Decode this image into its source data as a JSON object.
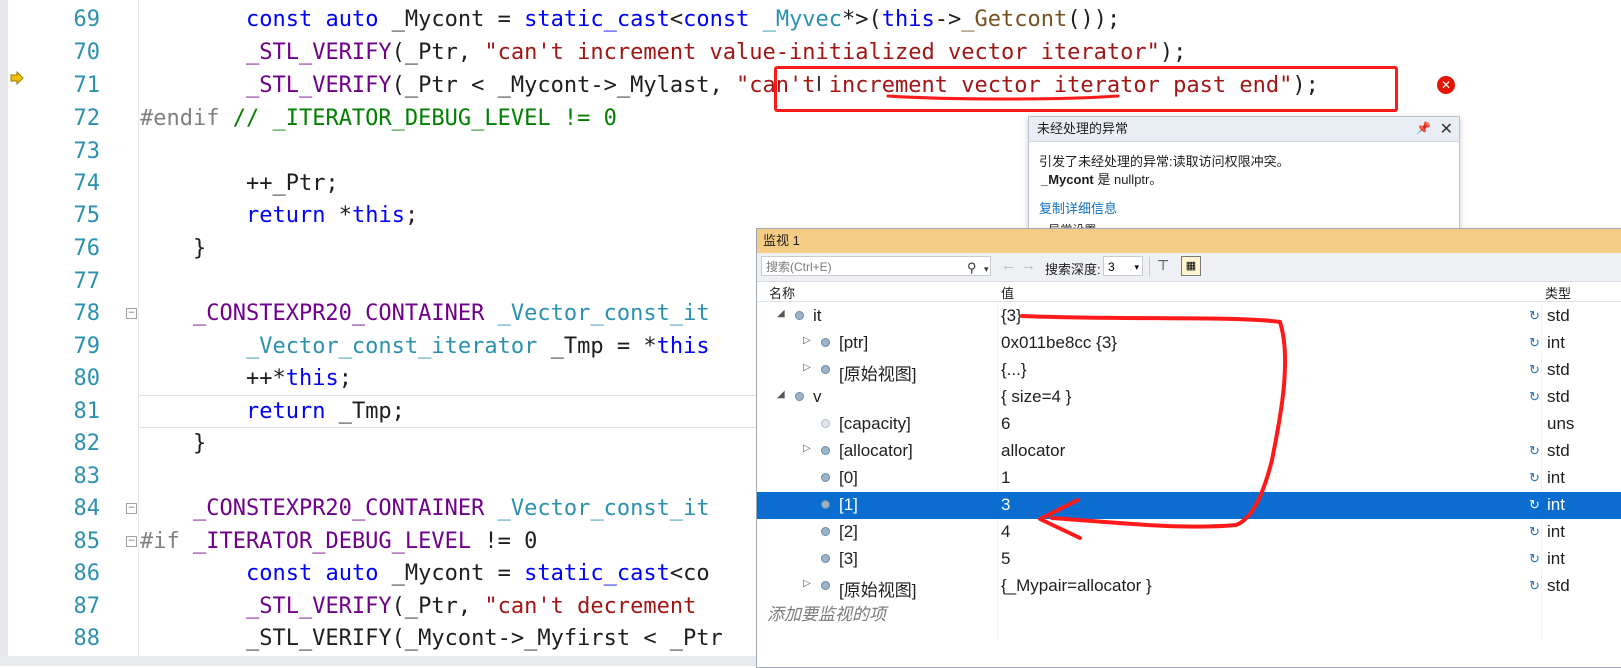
{
  "editor": {
    "lines": [
      {
        "num": "69"
      },
      {
        "num": "70"
      },
      {
        "num": "71"
      },
      {
        "num": "72"
      },
      {
        "num": "73"
      },
      {
        "num": "74"
      },
      {
        "num": "75"
      },
      {
        "num": "76"
      },
      {
        "num": "77"
      },
      {
        "num": "78"
      },
      {
        "num": "79"
      },
      {
        "num": "80"
      },
      {
        "num": "81"
      },
      {
        "num": "82"
      },
      {
        "num": "83"
      },
      {
        "num": "84"
      },
      {
        "num": "85"
      },
      {
        "num": "86"
      },
      {
        "num": "87"
      },
      {
        "num": "88"
      }
    ],
    "code": {
      "l69": {
        "a": "        ",
        "kw1": "const",
        "kw2": "auto",
        "b": " _Mycont = ",
        "kw3": "static_cast",
        "c": "<",
        "kw4": "const",
        "t1": " _Myvec",
        "d": "*>(",
        "kw5": "this",
        "e": "->",
        "fn1": "_Getcont",
        "f": "());"
      },
      "l70": {
        "a": "        ",
        "mac": "_STL_VERIFY",
        "b": "(_Ptr, ",
        "str": "\"can't increment value-initialized vector iterator\"",
        "c": ");"
      },
      "l71": {
        "a": "        ",
        "mac": "_STL_VERIFY",
        "b": "(_Ptr < _Mycont->_Mylast, ",
        "str": "\"can't increment vector iterator past end\"",
        "c": ");"
      },
      "l72": {
        "pre": "#endif",
        "cmt": " // _ITERATOR_DEBUG_LEVEL != 0"
      },
      "l74": {
        "a": "        ++_Ptr;"
      },
      "l75": {
        "a": "        ",
        "kw": "return",
        "b": " *",
        "kw2": "this",
        "c": ";"
      },
      "l76": {
        "a": "    }"
      },
      "l78": {
        "a": "    ",
        "mac": "_CONSTEXPR20_CONTAINER",
        "b": " ",
        "typ": "_Vector_const_it"
      },
      "l79": {
        "a": "        ",
        "typ": "_Vector_const_iterator",
        "b": " _Tmp = *",
        "kw": "this"
      },
      "l80": {
        "a": "        ++*",
        "kw": "this",
        "b": ";"
      },
      "l81": {
        "a": "        ",
        "kw": "return",
        "b": " _Tmp;"
      },
      "l82": {
        "a": "    }"
      },
      "l84": {
        "a": "    ",
        "mac": "_CONSTEXPR20_CONTAINER",
        "b": " ",
        "typ": "_Vector_const_it"
      },
      "l85": {
        "pre": "#if",
        "b": " ",
        "mac": "_ITERATOR_DEBUG_LEVEL",
        "c": " != 0"
      },
      "l86": {
        "a": "        ",
        "kw1": "const",
        "kw2": "auto",
        "b": " _Mycont = ",
        "kw3": "static_cast",
        "c": "<co"
      },
      "l87": {
        "a": "        ",
        "mac": "_STL_VERIFY",
        "b": "(_Ptr, ",
        "str": "\"can't decrement "
      },
      "l88": {
        "a": "        _STL_VERIFY(_Mycont->_Myfirst < _Ptr"
      }
    }
  },
  "exception_popup": {
    "title": "未经处理的异常",
    "pin": "📌",
    "close": "✕",
    "message": "引发了未经处理的异常:读取访问权限冲突。",
    "detail_var": "_Mycont",
    "detail_rest": " 是 nullptr。",
    "copy_link": "复制详细信息",
    "settings": "▸ 异常设置"
  },
  "watch": {
    "title": "监视 1",
    "search_placeholder": "搜索(Ctrl+E)",
    "depth_label": "搜索深度:",
    "depth_value": "3",
    "columns": {
      "name": "名称",
      "value": "值",
      "type": "类型"
    },
    "rows": [
      {
        "name": "it",
        "value": "{3}",
        "type": "std"
      },
      {
        "name": "[ptr]",
        "value": "0x011be8cc {3}",
        "type": "int"
      },
      {
        "name": "[原始视图]",
        "value": "{...}",
        "type": "std"
      },
      {
        "name": "v",
        "value": "{ size=4 }",
        "type": "std"
      },
      {
        "name": "[capacity]",
        "value": "6",
        "type": "uns"
      },
      {
        "name": "[allocator]",
        "value": "allocator",
        "type": "std"
      },
      {
        "name": "[0]",
        "value": "1",
        "type": "int"
      },
      {
        "name": "[1]",
        "value": "3",
        "type": "int"
      },
      {
        "name": "[2]",
        "value": "4",
        "type": "int"
      },
      {
        "name": "[3]",
        "value": "5",
        "type": "int"
      },
      {
        "name": "[原始视图]",
        "value": "{_Mypair=allocator }",
        "type": "std"
      }
    ],
    "add_watch": "添加要监视的项"
  },
  "colors": {
    "annotation": "#ff1a1a",
    "selection": "#0a6dcf",
    "watch_title": "#f5cc84"
  }
}
